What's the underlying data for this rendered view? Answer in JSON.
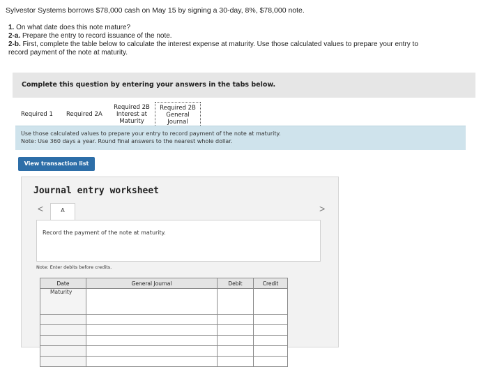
{
  "problem": {
    "intro": "Sylvestor Systems borrows $78,000 cash on May 15 by signing a 30-day, 8%, $78,000 note.",
    "questions": [
      {
        "num": "1.",
        "text": " On what date does this note mature?"
      },
      {
        "num": "2-a.",
        "text": " Prepare the entry to record issuance of the note."
      },
      {
        "num": "2-b.",
        "text": " First, complete the table below to calculate the interest expense at maturity. Use those calculated values to prepare your entry to"
      },
      {
        "num": "",
        "text": "record payment of the note at maturity."
      }
    ]
  },
  "complete_label": "Complete this question by entering your answers in the tabs below.",
  "tabs": [
    {
      "lines": [
        "Required 1"
      ],
      "active": false
    },
    {
      "lines": [
        "Required 2A"
      ],
      "active": false
    },
    {
      "lines": [
        "Required 2B",
        "Interest at",
        "Maturity"
      ],
      "active": false
    },
    {
      "lines": [
        "Required 2B",
        "General",
        "Journal"
      ],
      "active": true
    }
  ],
  "info": {
    "line1": "Use those calculated values to prepare your entry to record payment of the note at maturity.",
    "line2": "Note: Use 360 days a year. Round final answers to the nearest whole dollar."
  },
  "view_button": "View transaction list",
  "worksheet": {
    "title": "Journal entry worksheet",
    "prev_glyph": "<",
    "next_glyph": ">",
    "page_tab": "A",
    "instruction": "Record the payment of the note at maturity.",
    "note": "Note: Enter debits before credits."
  },
  "journal_table": {
    "headers": {
      "date": "Date",
      "general_journal": "General Journal",
      "debit": "Debit",
      "credit": "Credit"
    },
    "rows": [
      {
        "date": "Maturity"
      },
      {
        "date": ""
      },
      {
        "date": ""
      },
      {
        "date": ""
      },
      {
        "date": ""
      },
      {
        "date": ""
      }
    ]
  }
}
